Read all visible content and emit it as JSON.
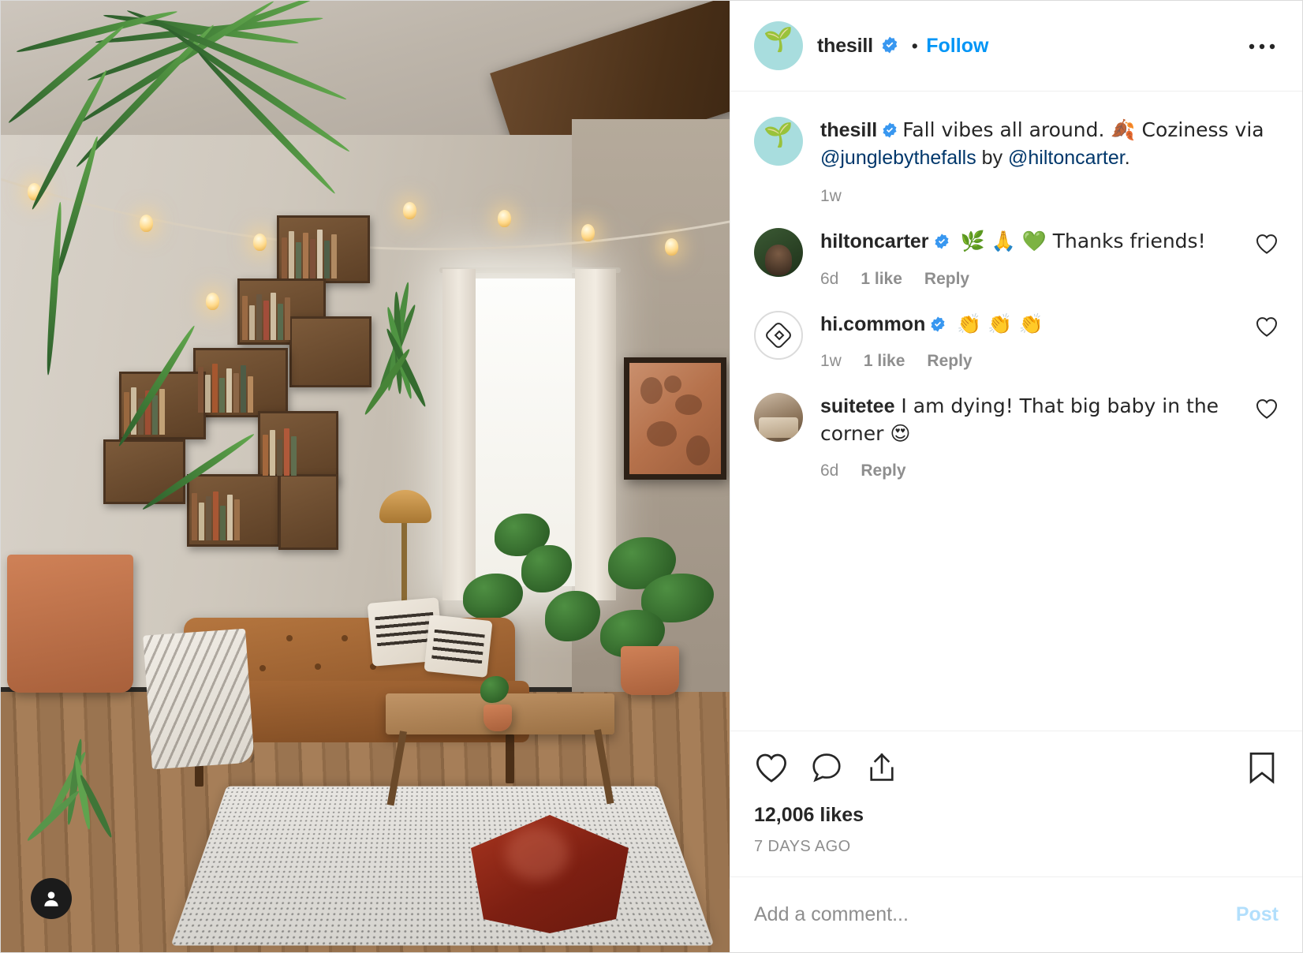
{
  "header": {
    "username": "thesill",
    "verified": true,
    "separator": "•",
    "follow_label": "Follow",
    "more_label": "···",
    "avatar_glyph": "🌱"
  },
  "caption": {
    "username": "thesill",
    "verified": true,
    "text_1": "Fall vibes all around. 🍂 Coziness via ",
    "mention_1": "@junglebythefalls",
    "text_2": " by ",
    "mention_2": "@hiltoncarter",
    "text_3": ".",
    "time": "1w"
  },
  "comments": [
    {
      "username": "hiltoncarter",
      "verified": true,
      "text": " 🌿 🙏 💚  Thanks friends!",
      "time": "6d",
      "likes": "1 like",
      "reply": "Reply",
      "avatar_type": "hc"
    },
    {
      "username": "hi.common",
      "verified": true,
      "text": " 👏 👏 👏",
      "time": "1w",
      "likes": "1 like",
      "reply": "Reply",
      "avatar_type": "hcm"
    },
    {
      "username": "suitetee",
      "verified": false,
      "text": " I am dying! That big baby in the corner 😍",
      "time": "6d",
      "likes": "",
      "reply": "Reply",
      "avatar_type": "st"
    }
  ],
  "actions": {
    "like_icon": "heart-icon",
    "comment_icon": "comment-icon",
    "share_icon": "share-icon",
    "save_icon": "bookmark-icon",
    "likes_count": "12,006 likes",
    "posted_ago": "7 DAYS AGO"
  },
  "add_comment": {
    "placeholder": "Add a comment...",
    "value": "",
    "post_label": "Post"
  },
  "colors": {
    "accent": "#0095f6",
    "verified": "#3897f0",
    "mention": "#00376b",
    "muted": "#8e8e8e",
    "text": "#262626",
    "post_disabled": "#b2dffc",
    "border": "#efefef"
  },
  "media": {
    "alt": "living room with leather sofa, plants, bookshelves and string lights",
    "profile_badge_icon": "person-icon"
  }
}
